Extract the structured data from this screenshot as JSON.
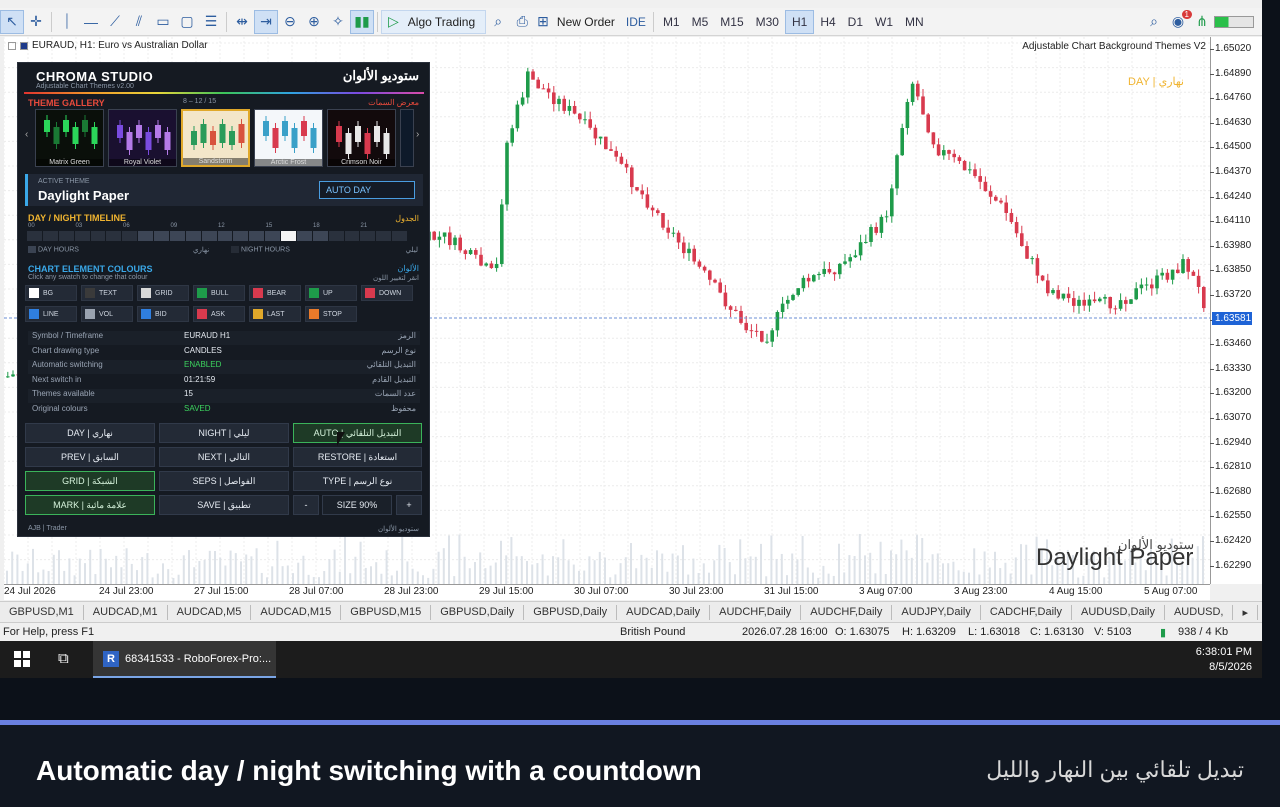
{
  "toolbar": {
    "algo_trading": "Algo Trading",
    "new_order": "New Order",
    "ide": "IDE",
    "timeframes": [
      "M1",
      "M5",
      "M15",
      "M30",
      "H1",
      "H4",
      "D1",
      "W1",
      "MN"
    ],
    "active_timeframe": "H1",
    "notif_count": "1"
  },
  "chart": {
    "symbol_label": "EURAUD, H1:  Euro vs Australian Dollar",
    "indicator": "Adjustable Chart Background Themes V2",
    "day_label": "DAY  |  نهاري",
    "watermark_ar": "ستوديو الألوان",
    "watermark": "Daylight Paper",
    "current_price": "1.63581",
    "price_ticks": [
      "1.65020",
      "1.64890",
      "1.64760",
      "1.64630",
      "1.64500",
      "1.64370",
      "1.64240",
      "1.64110",
      "1.63980",
      "1.63850",
      "1.63720",
      "1.63590",
      "1.63460",
      "1.63330",
      "1.63200",
      "1.63070",
      "1.62940",
      "1.62810",
      "1.62680",
      "1.62550",
      "1.62420",
      "1.62290"
    ],
    "time_ticks": [
      "24 Jul 2026",
      "24 Jul 23:00",
      "27 Jul 15:00",
      "28 Jul 07:00",
      "28 Jul 23:00",
      "29 Jul 15:00",
      "30 Jul 07:00",
      "30 Jul 23:00",
      "31 Jul 15:00",
      "3 Aug 07:00",
      "3 Aug 23:00",
      "4 Aug 15:00",
      "5 Aug 07:00"
    ]
  },
  "panel": {
    "title": "CHROMA STUDIO",
    "subtitle": "Adjustable Chart Themes  v2.00",
    "title_ar": "ستوديو الألوان",
    "gallery_label": "THEME GALLERY",
    "gallery_count": "8 – 12 / 15",
    "gallery_label_ar": "معرض السمات",
    "themes": [
      "Matrix Green",
      "Royal Violet",
      "Sandstorm",
      "Arctic Frost",
      "Crimson Noir"
    ],
    "active_label": "ACTIVE THEME",
    "active_name": "Daylight Paper",
    "active_mode": "AUTO  DAY",
    "timeline_label": "DAY / NIGHT TIMELINE",
    "timeline_label_ar": "الجدول",
    "hours": [
      "00",
      "03",
      "06",
      "09",
      "12",
      "15",
      "18",
      "21"
    ],
    "day_hours": "DAY HOURS",
    "day_hours_ar": "نهاري",
    "night_hours": "NIGHT HOURS",
    "night_hours_ar": "ليلي",
    "elements_label": "CHART ELEMENT COLOURS",
    "elements_label_ar": "الألوان",
    "elements_sub": "Click any swatch to change that colour",
    "elements_sub_ar": "انقر لتغيير اللون",
    "swatches": [
      {
        "label": "BG",
        "color": "#ffffff"
      },
      {
        "label": "TEXT",
        "color": "#3a3a3a"
      },
      {
        "label": "GRID",
        "color": "#d8d8d8"
      },
      {
        "label": "BULL",
        "color": "#1e9b4a"
      },
      {
        "label": "BEAR",
        "color": "#d83a4e"
      },
      {
        "label": "UP",
        "color": "#1e9b4a"
      },
      {
        "label": "DOWN",
        "color": "#d83a4e"
      },
      {
        "label": "LINE",
        "color": "#2f7fe0"
      },
      {
        "label": "VOL",
        "color": "#9aa3b0"
      },
      {
        "label": "BID",
        "color": "#2f7fe0"
      },
      {
        "label": "ASK",
        "color": "#d83a4e"
      },
      {
        "label": "LAST",
        "color": "#e0a82a"
      },
      {
        "label": "STOP",
        "color": "#e87a2a"
      }
    ],
    "info": [
      {
        "key": "Symbol / Timeframe",
        "value": "EURAUD  H1",
        "ar": "الرمز"
      },
      {
        "key": "Chart drawing type",
        "value": "CANDLES",
        "ar": "نوع الرسم"
      },
      {
        "key": "Automatic switching",
        "value": "ENABLED",
        "ar": "التبديل التلقائي"
      },
      {
        "key": "Next switch in",
        "value": "01:21:59",
        "ar": "التبديل القادم"
      },
      {
        "key": "Themes available",
        "value": "15",
        "ar": "عدد السمات"
      },
      {
        "key": "Original colours",
        "value": "SAVED",
        "ar": "محفوظ"
      }
    ],
    "buttons": {
      "day": "DAY | نهاري",
      "night": "NIGHT | ليلي",
      "auto": "AUTO | التبديل التلقائي",
      "prev": "PREV | السابق",
      "next": "NEXT | التالي",
      "restore": "RESTORE | استعادة",
      "grid": "GRID | الشبكة",
      "seps": "SEPS | الفواصل",
      "type": "TYPE | نوع الرسم",
      "mark": "MARK | علامة مائية",
      "save": "SAVE | تطبيق",
      "minus": "-",
      "size": "SIZE 90%",
      "plus": "+"
    },
    "footer": "AJB  |  Trader",
    "footer_ar": "ستوديو الألوان"
  },
  "tabs": [
    "GBPUSD,M1",
    "AUDCAD,M1",
    "AUDCAD,M5",
    "AUDCAD,M15",
    "GBPUSD,M15",
    "GBPUSD,Daily",
    "GBPUSD,Daily",
    "AUDCAD,Daily",
    "AUDCHF,Daily",
    "AUDCHF,Daily",
    "AUDJPY,Daily",
    "CADCHF,Daily",
    "AUDUSD,Daily",
    "AUDUSD,"
  ],
  "status": {
    "help": "For Help, press F1",
    "profile": "British Pound",
    "datetime": "2026.07.28 16:00",
    "open": "O: 1.63075",
    "high": "H: 1.63209",
    "low": "L: 1.63018",
    "close": "C: 1.63130",
    "volume": "V: 5103",
    "traffic": "938 / 4 Kb"
  },
  "taskbar": {
    "app": "68341533 - RoboForex-Pro:...",
    "time": "6:38:01 PM",
    "date": "8/5/2026"
  },
  "caption": {
    "title": "Automatic day / night switching with a countdown",
    "title_ar": "تبديل تلقائي بين النهار والليل"
  }
}
